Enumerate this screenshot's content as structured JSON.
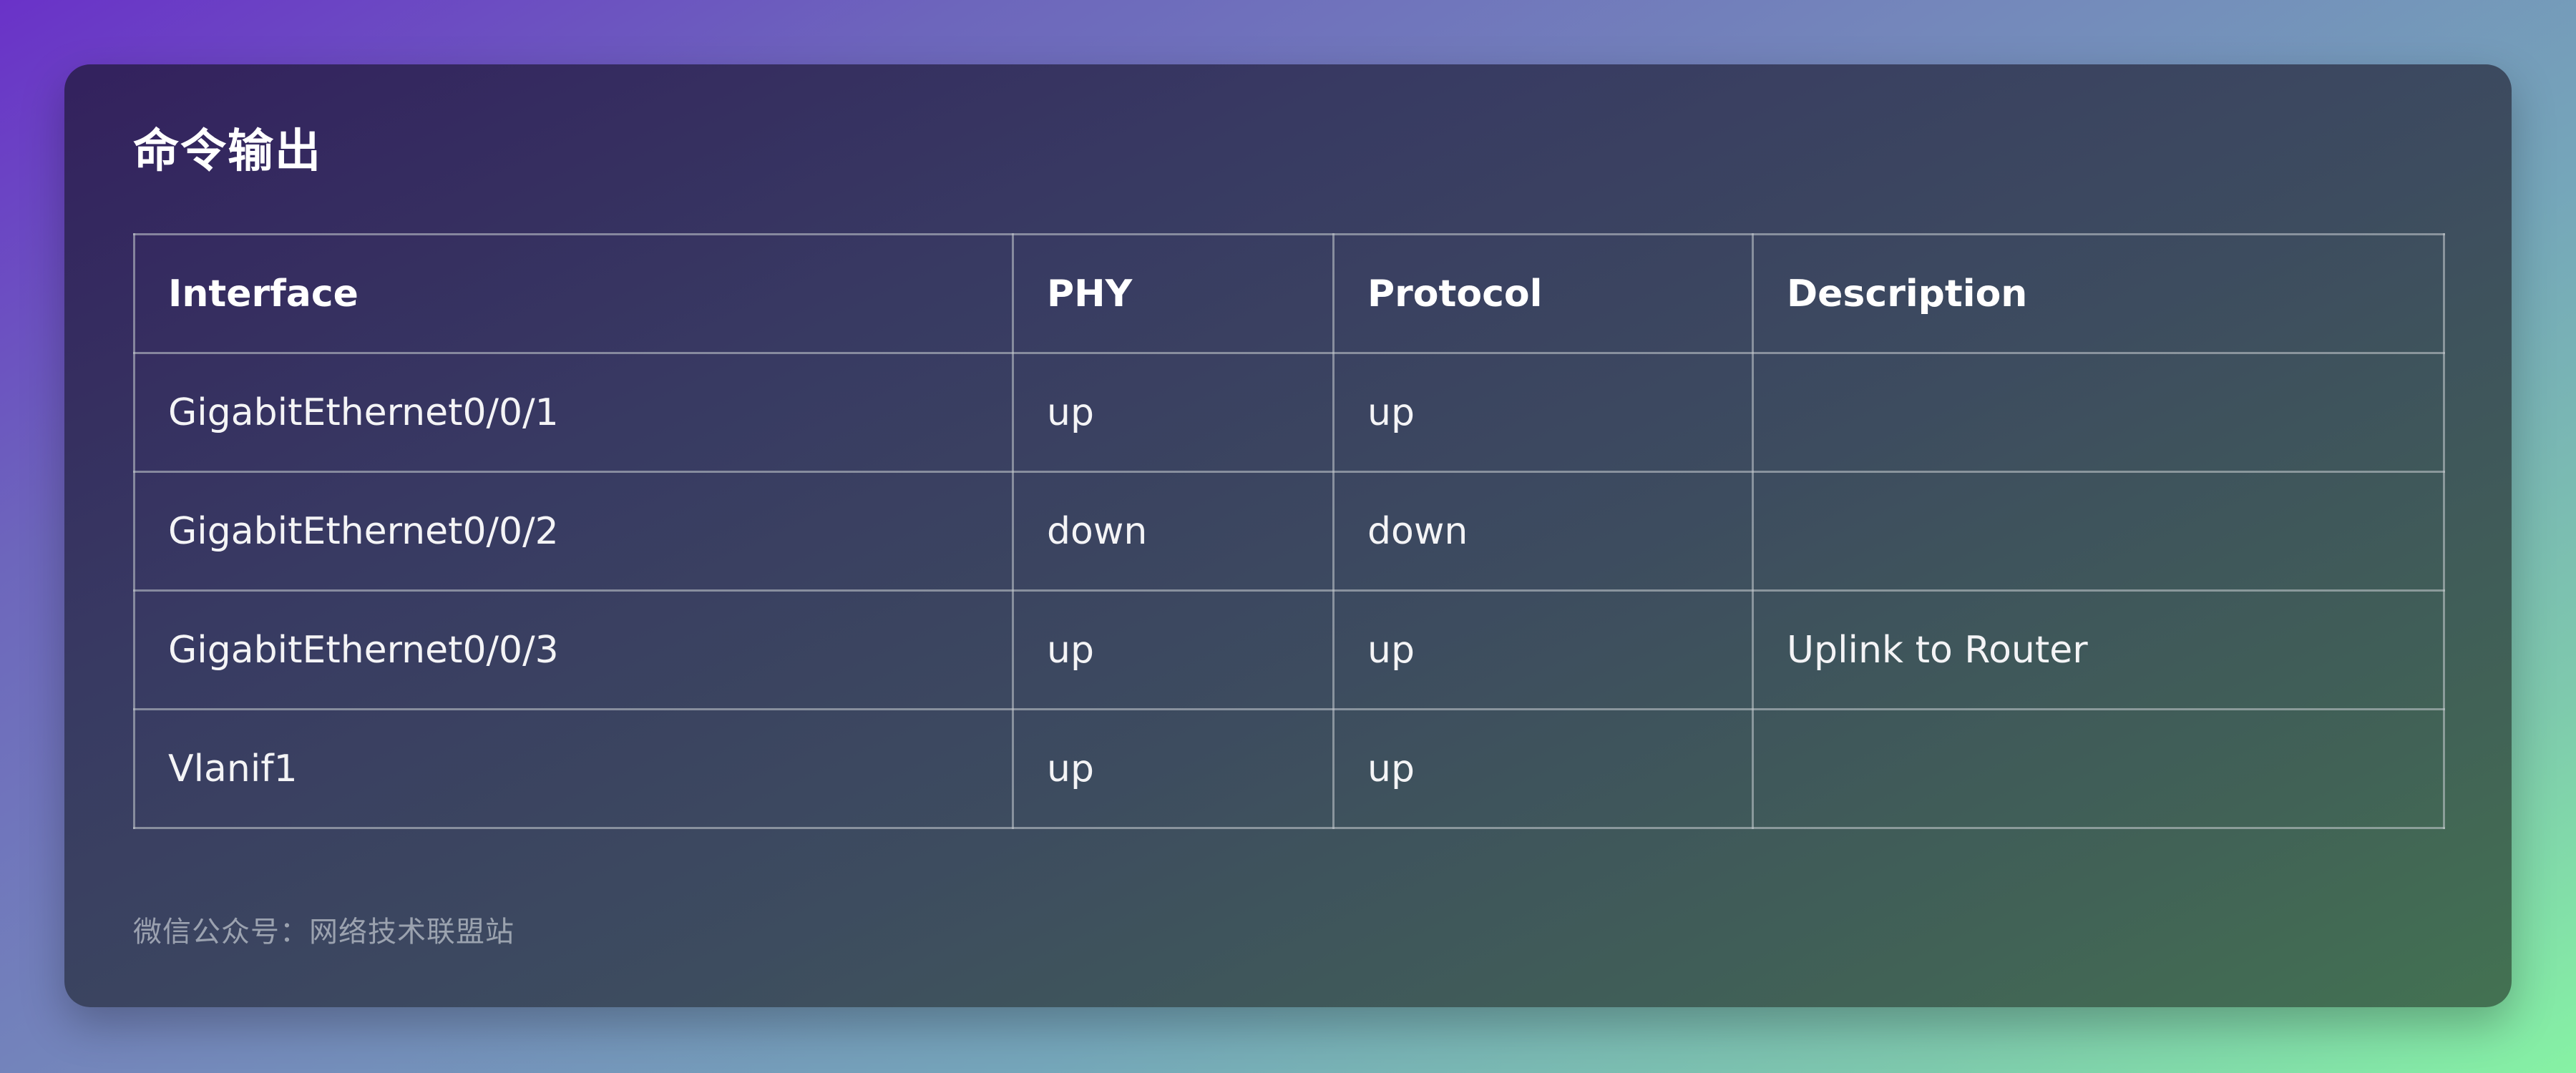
{
  "card": {
    "title": "命令输出",
    "footer": "微信公众号：网络技术联盟站"
  },
  "table": {
    "headers": [
      "Interface",
      "PHY",
      "Protocol",
      "Description"
    ],
    "rows": [
      [
        "GigabitEthernet0/0/1",
        "up",
        "up",
        ""
      ],
      [
        "GigabitEthernet0/0/2",
        "down",
        "down",
        ""
      ],
      [
        "GigabitEthernet0/0/3",
        "up",
        "up",
        "Uplink to Router"
      ],
      [
        "Vlanif1",
        "up",
        "up",
        ""
      ]
    ]
  },
  "colors": {
    "card_background_start": "#33215e",
    "card_background_end": "#437252",
    "page_background_start": "#6a32c8",
    "page_background_end": "#86f2a4",
    "text": "#f4f4f6"
  }
}
